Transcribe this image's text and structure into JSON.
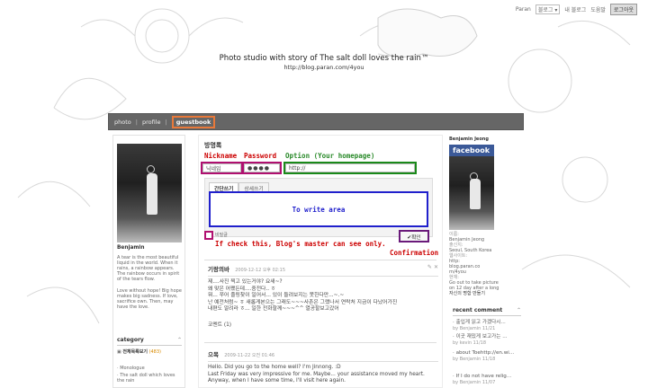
{
  "topbar": {
    "service": "Paran",
    "dropdown": "블로그",
    "my_blog": "내 블로그",
    "help": "도움말",
    "logout": "로그아웃"
  },
  "site": {
    "title": "Photo studio with story of The salt doll loves the rain™",
    "url": "http://blog.paran.com/4you"
  },
  "nav": {
    "items": [
      "photo",
      "profile",
      "guestbook"
    ],
    "active": "guestbook"
  },
  "left": {
    "name": "Benjamin",
    "bio": "A tear is the most beautiful liquid in the world. When it rains, a rainbow appears. The rainbow occurs in spirit of the tears flow.",
    "bio2": "Love without hope! Big hope makes big sadness. If love, sacrifice own. Then, may have the love.",
    "category_title": "category",
    "category_all": "전체목록보기",
    "category_count": "(483)",
    "category_items": [
      "Monologue",
      "The salt doll which loves the rain"
    ]
  },
  "main": {
    "section_title": "방명록",
    "anno_nickname": "Nickname",
    "anno_password": "Password",
    "anno_option": "Option (Your homepage)",
    "nickname_value": "닉네임",
    "password_value": "●●●●",
    "homepage_value": "http://",
    "tab_simple": "간단쓰기",
    "tab_detail": "상세쓰기",
    "write_area_label": "To write area",
    "secret_label": "비밀글",
    "anno_secret": "If check this, Blog's master can see only.",
    "confirm_label": "✔확인",
    "anno_confirm": "Confirmation",
    "posts": [
      {
        "author": "기랑의바",
        "time": "2009-12-12 오후 02:15",
        "body": [
          "제....사진 찍고 있는거야? 요새~?",
          "왜 맞은 어쨌든데....중전다.. ㅎ",
          "뭐... 쭈어 졸링찾이 일어서... 있이 들려보지는 못한다만...~.~",
          "난 예전처럼~ ㅎ 새롭게본으는 그래도~~~사촌은 그랬나서 연락처 지금이 다났어가진",
          "내편도 알려라 ㅎ... 일한 전화할께~~~^^ 열공할보고갔어"
        ],
        "comment": "코멘트 (1)"
      },
      {
        "author": "으목",
        "time": "2009-11-22 오전 01:46",
        "body": [
          "Hello. Did you go to the home well? I'm Jinnong. :D",
          "Last Friday was very impressive for me. Maybe... your assistance moved my heart.",
          "Anyway, when I have some time, I'll visit here again."
        ]
      }
    ]
  },
  "right": {
    "name": "Benjamin Jeong",
    "facebook": "facebook",
    "profile_lines": [
      "이름:",
      "Benjamin Jeong",
      "출신지:",
      "Seoul, South Korea",
      "웹사이트:",
      "http:",
      "blog.paran.co",
      "m/4you",
      "현재:",
      "Go out to take picture on 12 day after a long",
      "자신의 명함 만들기"
    ],
    "recent_title": "recent comment",
    "recent": [
      {
        "text": "출입게 읽고 가겠다시...",
        "who": "by Benjamin 11/21"
      },
      {
        "text": "이곳 재밌게 보고가는 ...",
        "who": "by kevin 11/18"
      },
      {
        "text": "about Toehttp://en.wi...",
        "who": "by Benjamin 11/18"
      },
      {
        "text": "If I do not have relig...",
        "who": "by Benjamin 11/07"
      }
    ]
  }
}
